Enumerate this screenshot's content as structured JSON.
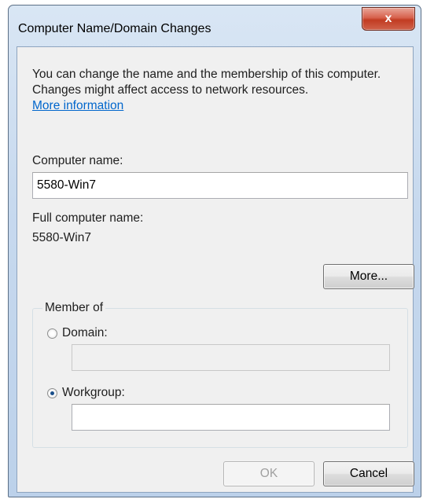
{
  "window": {
    "title": "Computer Name/Domain Changes",
    "close_glyph": "x"
  },
  "description": {
    "text": "You can change the name and the membership of this computer. Changes might affect access to network resources.",
    "link": "More information"
  },
  "computer_name": {
    "label": "Computer name:",
    "value": "5580-Win7"
  },
  "full_computer_name": {
    "label": "Full computer name:",
    "value": "5580-Win7"
  },
  "more_button": "More...",
  "member_of": {
    "legend": "Member of",
    "domain_label": "Domain:",
    "domain_value": "",
    "domain_selected": false,
    "workgroup_label": "Workgroup:",
    "workgroup_value": "",
    "workgroup_selected": true
  },
  "buttons": {
    "ok": "OK",
    "cancel": "Cancel"
  }
}
